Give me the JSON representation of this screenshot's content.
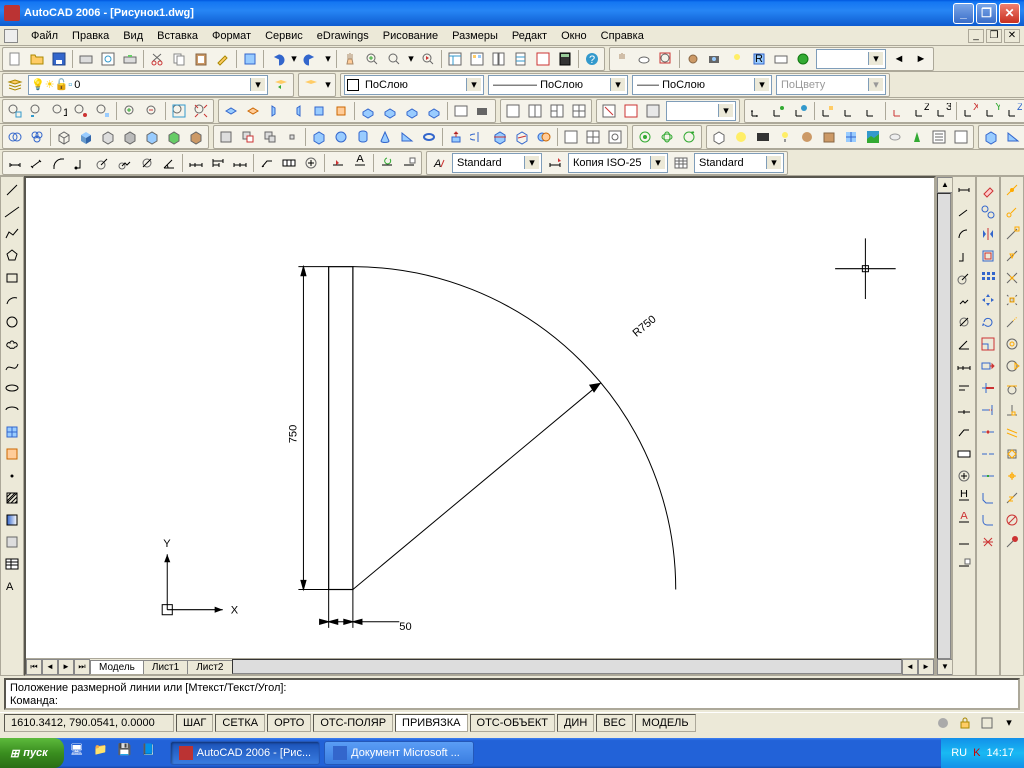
{
  "title": "AutoCAD 2006 - [Рисунок1.dwg]",
  "menu": [
    "Файл",
    "Правка",
    "Вид",
    "Вставка",
    "Формат",
    "Сервис",
    "eDrawings",
    "Рисование",
    "Размеры",
    "Редакт",
    "Окно",
    "Справка"
  ],
  "layer": "0",
  "bylayer": "ПоСлою",
  "bycolor": "ПоЦвету",
  "textStyle": "Standard",
  "dimStyle": "Копия ISO-25",
  "tableStyle": "Standard",
  "tabs": {
    "model": "Модель",
    "l1": "Лист1",
    "l2": "Лист2"
  },
  "cmd1": "Положение размерной линии или [Мтекст/Текст/Угол]:",
  "cmd2": "Команда:",
  "coords": "1610.3412, 790.0541, 0.0000",
  "status": {
    "snap": "ШАГ",
    "grid": "СЕТКА",
    "ortho": "ОРТО",
    "polar": "ОТС-ПОЛЯР",
    "osnap": "ПРИВЯЗКА",
    "otrack": "ОТС-ОБЪЕКТ",
    "dyn": "ДИН",
    "lwt": "ВЕС",
    "model": "МОДЕЛЬ"
  },
  "drawing": {
    "dim1": "750",
    "dim2": "50",
    "dimR": "R750",
    "axisX": "X",
    "axisY": "Y"
  },
  "start": "пуск",
  "task1": "AutoCAD 2006 - [Рис...",
  "task2": "Документ Microsoft ...",
  "lang": "RU",
  "time": "14:17"
}
